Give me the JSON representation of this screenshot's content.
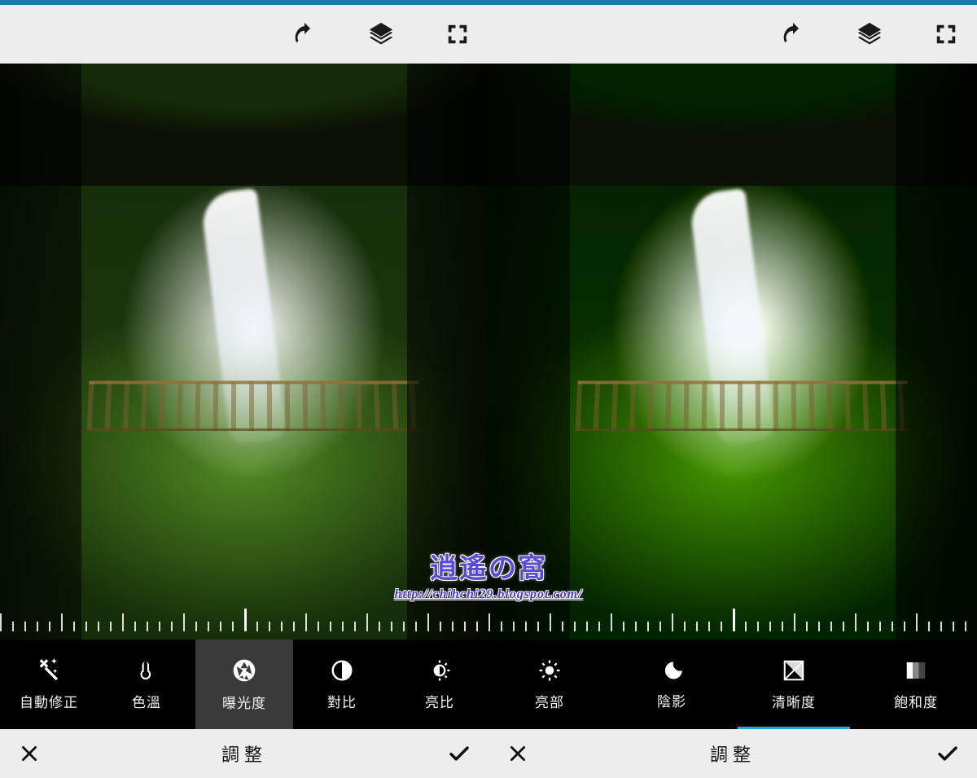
{
  "watermark": {
    "main": "逍遙の窩",
    "sub": "http://chihchi29.blogspot.com/"
  },
  "panes": [
    {
      "side": "left",
      "topbar": {
        "icons": [
          "undo",
          "layers",
          "fullscreen"
        ]
      },
      "tools": [
        {
          "id": "auto-fix",
          "label": "自動修正",
          "icon": "wand",
          "selected": false
        },
        {
          "id": "temperature",
          "label": "色溫",
          "icon": "thermometer",
          "selected": false
        },
        {
          "id": "exposure",
          "label": "曝光度",
          "icon": "aperture",
          "selected": true,
          "style": "bg"
        },
        {
          "id": "contrast",
          "label": "對比",
          "icon": "contrast",
          "selected": false
        },
        {
          "id": "brightness",
          "label": "亮比",
          "icon": "half-sun",
          "selected": false
        }
      ],
      "bottombar": {
        "title": "調整",
        "cancel": "✕",
        "confirm": "✓"
      },
      "slider_value": 0
    },
    {
      "side": "right",
      "topbar": {
        "icons": [
          "undo",
          "layers",
          "fullscreen"
        ]
      },
      "tools": [
        {
          "id": "highlights",
          "label": "亮部",
          "icon": "sun",
          "selected": false
        },
        {
          "id": "shadows",
          "label": "陰影",
          "icon": "moon",
          "selected": false
        },
        {
          "id": "clarity",
          "label": "清晰度",
          "icon": "clarity",
          "selected": true,
          "style": "line"
        },
        {
          "id": "saturation",
          "label": "飽和度",
          "icon": "squares",
          "selected": false
        }
      ],
      "bottombar": {
        "title": "調整",
        "cancel": "✕",
        "confirm": "✓"
      },
      "slider_value": 0
    }
  ]
}
